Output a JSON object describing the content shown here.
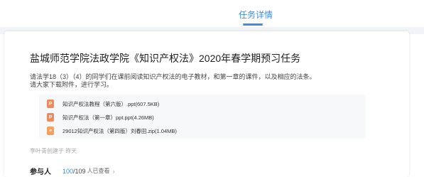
{
  "tabs": {
    "active_label": "任务详情"
  },
  "task": {
    "title": "盐城师范学院法政学院《知识产权法》2020年春学期预习任务",
    "description_line1": "请法学18（3）（4）的同学们在课前阅读知识产权法的电子教材，和第一章的课件，以及相应的法条。",
    "description_line2": "请大家下载附件，进行学习。",
    "attachments": [
      {
        "icon": "ppt-file-icon",
        "name": "知识产权法教程（第六版）.ppt(607.5KB)"
      },
      {
        "icon": "ppt-file-icon",
        "name": "知识产权法（第一章）ppt.ppt(4.26MB)"
      },
      {
        "icon": "zip-file-icon",
        "name": "29012知识产权法（第四版）刘春田.zip(1.04MB)"
      }
    ],
    "meta": "李叶青创建于 昨天"
  },
  "participants": {
    "label": "参与人",
    "viewed_count": "100",
    "total": "/109",
    "viewed_text": "人已查看",
    "chevron": "›"
  },
  "colors": {
    "accent": "#3a8ee6",
    "ppt": "#f08a5d",
    "zip": "#f2a05c"
  }
}
